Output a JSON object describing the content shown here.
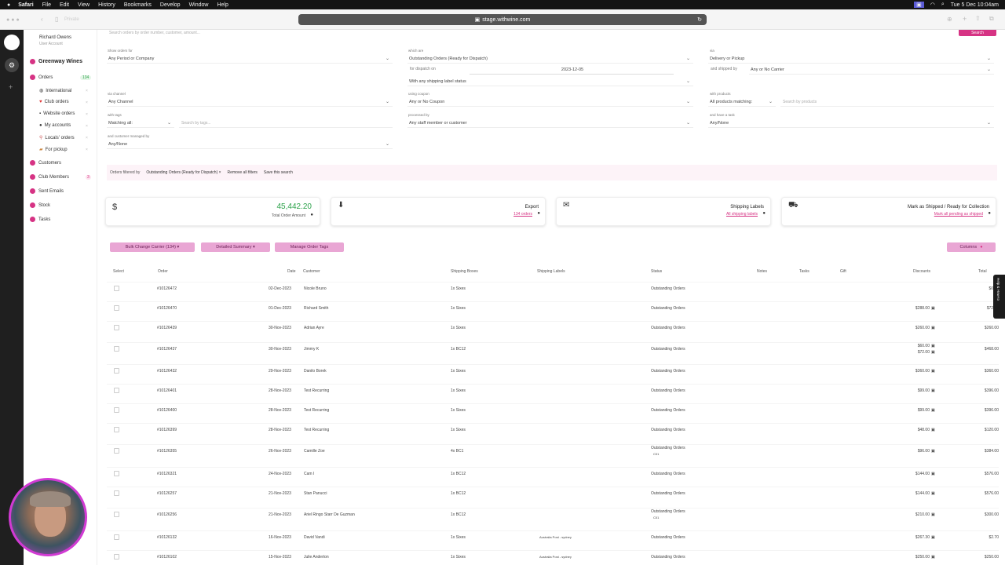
{
  "menubar": {
    "app": "Safari",
    "items": [
      "File",
      "Edit",
      "View",
      "History",
      "Bookmarks",
      "Develop",
      "Window",
      "Help"
    ],
    "clock": "Tue 5 Dec 10:04am"
  },
  "browser": {
    "sidebar_label": "Private",
    "url": "stage.withwine.com"
  },
  "sidebar": {
    "user_name": "Richard Owens",
    "user_role": "User Account",
    "brand": "Greenway Wines",
    "items": [
      {
        "label": "Orders",
        "badge": "134"
      },
      {
        "label": "Customers"
      },
      {
        "label": "Club Members",
        "badge": "3"
      },
      {
        "label": "Sent Emails"
      },
      {
        "label": "Stock"
      },
      {
        "label": "Tasks"
      }
    ],
    "sub_items": [
      "International",
      "Club orders",
      "Website orders",
      "My accounts",
      "Locals' orders",
      "For pickup"
    ]
  },
  "filters": {
    "search_placeholder": "Search orders by order number, customer, amount...",
    "search_button": "Search",
    "show_orders_for_label": "Show orders for",
    "show_orders_for_value": "Any Period or Company",
    "which_are_label": "which are",
    "which_are_value": "Outstanding Orders (Ready for Dispatch)",
    "via_label": "via",
    "via_value": "Delivery or Pickup",
    "for_dispatch_label": "for dispatch on",
    "dispatch_date": "2023-12-05",
    "shipped_by_label": "and shipped by",
    "shipped_by_value": "Any or No Carrier",
    "label_status_value": "With any shipping label status",
    "via_channel_label": "via channel",
    "via_channel_value": "Any Channel",
    "coupon_label": "using coupon",
    "coupon_value": "Any or No Coupon",
    "products_label": "with products",
    "products_value": "All products matching:",
    "products_search_placeholder": "Search by products",
    "tags_label": "with tags",
    "tags_value": "Matching all:",
    "tags_search_placeholder": "Search by tags...",
    "processed_label": "processed by",
    "processed_value": "Any staff member or customer",
    "task_label": "and have a task",
    "task_value": "Any/None",
    "managed_label": "and customer managed by",
    "managed_value": "Any/None"
  },
  "filter_summary": {
    "prefix": "Orders filtered by",
    "active_filter": "Outstanding Orders (Ready for Dispatch) ×",
    "remove_all": "Remove all filters",
    "save_search": "Save this search"
  },
  "cards": {
    "total_amount": "45,442.20",
    "total_label": "Total Order Amount",
    "export_title": "Export",
    "export_sub": "134 orders",
    "labels_title": "Shipping Labels",
    "labels_sub": "All shipping labels",
    "shipped_title": "Mark as Shipped / Ready for Collection",
    "shipped_sub": "Mark all pending as shipped"
  },
  "actions": {
    "bulk_change": "Bulk Change Carrier (134) ▾",
    "detailed_summary": "Detailed Summary ▾",
    "manage_tags": "Manage Order Tags",
    "columns": "Columns"
  },
  "table": {
    "headers": {
      "select": "Select",
      "order": "Order",
      "date": "Date",
      "customer": "Customer",
      "boxes": "Shipping Boxes",
      "labels": "Shipping Labels",
      "status": "Status",
      "notes": "Notes",
      "tasks": "Tasks",
      "gift": "Gift",
      "discounts": "Discounts",
      "total": "Total"
    },
    "rows": [
      {
        "order": "#10126472",
        "date": "02-Dec-2023",
        "customer": "Nicole Bruno",
        "boxes": "1x Sixes",
        "label": "",
        "status": "Outstanding Orders",
        "tag": "",
        "discount": "",
        "discount2": "",
        "total": "$0.00"
      },
      {
        "order": "#10126470",
        "date": "01-Dec-2023",
        "customer": "Richard Smith",
        "boxes": "1x Sixes",
        "label": "",
        "status": "Outstanding Orders",
        "tag": "",
        "discount": "$288.00",
        "discount2": "",
        "total": "$72.00"
      },
      {
        "order": "#10126439",
        "date": "30-Nov-2023",
        "customer": "Adrian Ayre",
        "boxes": "1x Sixes",
        "label": "",
        "status": "Outstanding Orders",
        "tag": "",
        "discount": "$260.00",
        "discount2": "",
        "total": "$260.00"
      },
      {
        "order": "#10126437",
        "date": "30-Nov-2023",
        "customer": "Jimmy K",
        "boxes": "1x BC12",
        "label": "",
        "status": "Outstanding Orders",
        "tag": "",
        "discount": "$60.00",
        "discount2": "$72.00",
        "total": "$468.00"
      },
      {
        "order": "#10126432",
        "date": "29-Nov-2023",
        "customer": "Danilo Borek",
        "boxes": "1x Sixes",
        "label": "",
        "status": "Outstanding Orders",
        "tag": "",
        "discount": "$360.00",
        "discount2": "",
        "total": "$360.00"
      },
      {
        "order": "#10126401",
        "date": "28-Nov-2023",
        "customer": "Test Recurring",
        "boxes": "1x Sixes",
        "label": "",
        "status": "Outstanding Orders",
        "tag": "",
        "discount": "$99.00",
        "discount2": "",
        "total": "$396.00"
      },
      {
        "order": "#10126400",
        "date": "28-Nov-2023",
        "customer": "Test Recurring",
        "boxes": "1x Sixes",
        "label": "",
        "status": "Outstanding Orders",
        "tag": "",
        "discount": "$99.00",
        "discount2": "",
        "total": "$396.00"
      },
      {
        "order": "#10126399",
        "date": "28-Nov-2023",
        "customer": "Test Recurring",
        "boxes": "1x Sixes",
        "label": "",
        "status": "Outstanding Orders",
        "tag": "",
        "discount": "$48.00",
        "discount2": "",
        "total": "$120.00"
      },
      {
        "order": "#10126355",
        "date": "26-Nov-2023",
        "customer": "Camille Zoe",
        "boxes": "4x BC1",
        "label": "",
        "status": "Outstanding Orders",
        "tag": "C01",
        "discount": "$96.00",
        "discount2": "",
        "total": "$384.00"
      },
      {
        "order": "#10126321",
        "date": "24-Nov-2023",
        "customer": "Cam I",
        "boxes": "1x BC12",
        "label": "",
        "status": "Outstanding Orders",
        "tag": "",
        "discount": "$144.00",
        "discount2": "",
        "total": "$576.00"
      },
      {
        "order": "#10126257",
        "date": "21-Nov-2023",
        "customer": "Stan Panucci",
        "boxes": "1x BC12",
        "label": "",
        "status": "Outstanding Orders",
        "tag": "",
        "discount": "$144.00",
        "discount2": "",
        "total": "$576.00"
      },
      {
        "order": "#10126256",
        "date": "21-Nov-2023",
        "customer": "Ariel Ringo Starr De Guzman",
        "boxes": "1x BC12",
        "label": "",
        "status": "Outstanding Orders",
        "tag": "C01",
        "discount": "$210.00",
        "discount2": "",
        "total": "$300.00"
      },
      {
        "order": "#10126132",
        "date": "16-Nov-2023",
        "customer": "David Vandi",
        "boxes": "1x Sixes",
        "label": "Australia Post - sydney",
        "status": "Outstanding Orders",
        "tag": "",
        "discount": "$267.30",
        "discount2": "",
        "total": "$2.70"
      },
      {
        "order": "#10126102",
        "date": "15-Nov-2023",
        "customer": "Julie Anderton",
        "boxes": "1x Sixes",
        "label": "Australia Post - sydney",
        "status": "Outstanding Orders",
        "tag": "",
        "discount": "$250.00",
        "discount2": "",
        "total": "$250.00"
      }
    ]
  },
  "help_tab": "Help & How-to",
  "colors": {
    "accent": "#d63384",
    "pill": "#e9a6d4",
    "green": "#2ca24a"
  }
}
